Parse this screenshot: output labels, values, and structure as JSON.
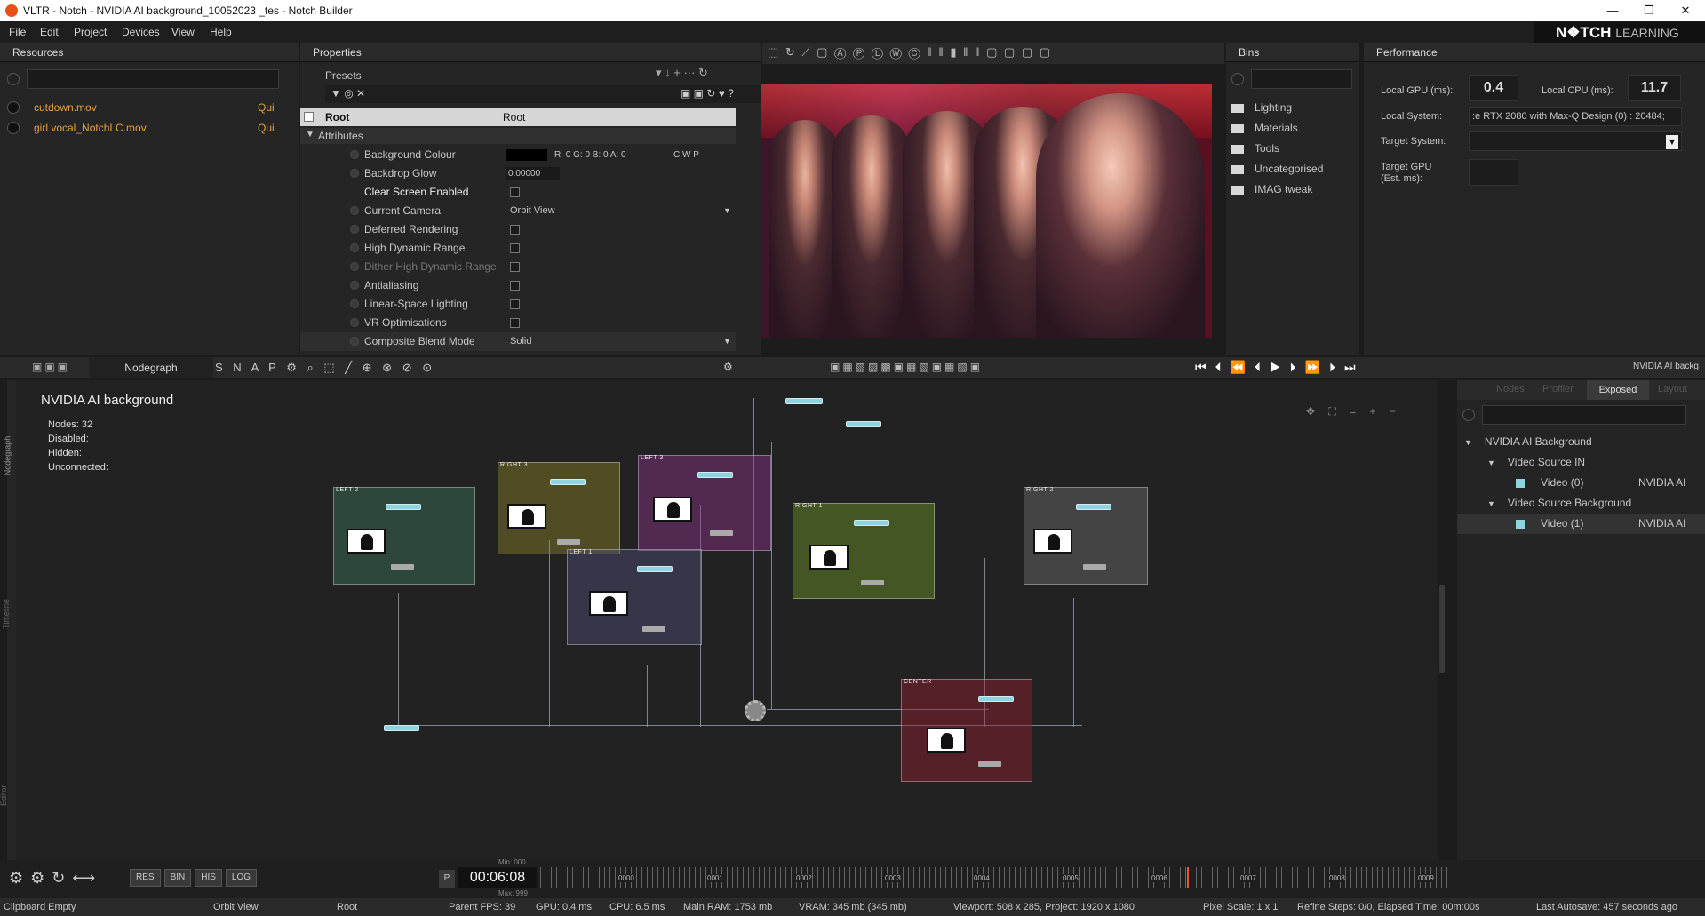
{
  "window": {
    "title": "VLTR - Notch - NVIDIA AI background_10052023 _tes - Notch Builder",
    "min": "—",
    "max": "❐",
    "close": "✕"
  },
  "menu": [
    "File",
    "Edit",
    "Project",
    "Devices",
    "View",
    "Help"
  ],
  "brand": {
    "name": "N❖TCH",
    "sub": "LEARNING"
  },
  "resources": {
    "title": "Resources",
    "items": [
      {
        "name": "cutdown.mov",
        "tag": "Qui"
      },
      {
        "name": "girl vocal_NotchLC.mov",
        "tag": "Qui"
      }
    ]
  },
  "properties": {
    "title": "Properties",
    "presets": "Presets",
    "root": {
      "label": "Root",
      "value": "Root"
    },
    "section": "Attributes",
    "rows": [
      {
        "label": "Background Colour",
        "value": "R: 0 G: 0 B: 0 A: 0",
        "extra": "C   W   P"
      },
      {
        "label": "Backdrop Glow",
        "value": "0.00000"
      },
      {
        "label": "Clear Screen Enabled",
        "value": ""
      },
      {
        "label": "Current Camera",
        "value": "Orbit View"
      },
      {
        "label": "Deferred Rendering",
        "value": ""
      },
      {
        "label": "High Dynamic Range",
        "value": ""
      },
      {
        "label": "Dither High Dynamic Range",
        "value": ""
      },
      {
        "label": "Antialiasing",
        "value": ""
      },
      {
        "label": "Linear-Space Lighting",
        "value": ""
      },
      {
        "label": "VR Optimisations",
        "value": ""
      },
      {
        "label": "Composite Blend Mode",
        "value": "Solid"
      }
    ]
  },
  "bins": {
    "title": "Bins",
    "items": [
      "Lighting",
      "Materials",
      "Tools",
      "Uncategorised",
      "IMAG tweak"
    ]
  },
  "performance": {
    "title": "Performance",
    "local_gpu_label": "Local GPU (ms):",
    "local_gpu": "0.4",
    "local_cpu_label": "Local CPU (ms):",
    "local_cpu": "11.7",
    "local_system_label": "Local System:",
    "local_system": ":e RTX 2080 with Max-Q Design (0) : 20484;",
    "target_system_label": "Target System:",
    "target_gpu_label": "Target GPU",
    "target_gpu_sub": "(Est. ms):"
  },
  "toolbar": {
    "snap": "S N A P",
    "nodegraph_tab": "Nodegraph",
    "viewport_label": "NVIDIA AI backg"
  },
  "nodegraph": {
    "title": "NVIDIA  AI  background",
    "nodes_label": "Nodes:",
    "nodes": "32",
    "disabled": "Disabled:",
    "hidden": "Hidden:",
    "unconnected": "Unconnected:",
    "side_tabs": [
      "Nodegraph",
      "Timeline",
      "Curve Editor"
    ],
    "groups": [
      "LEFT  2",
      "RIGHT  3",
      "LEFT  3",
      "LEFT  1",
      "RIGHT  1",
      "RIGHT  2",
      "CENTER"
    ]
  },
  "exposed": {
    "tabs": [
      "Nodes",
      "Profiler",
      "Exposed",
      "Layout"
    ],
    "tree": [
      {
        "label": "NVIDIA AI Background",
        "level": 0
      },
      {
        "label": "Video Source IN",
        "level": 1
      },
      {
        "label": "Video (0)",
        "level": 2,
        "value": "NVIDIA AI"
      },
      {
        "label": "Video Source Background",
        "level": 1
      },
      {
        "label": "Video (1)",
        "level": 2,
        "value": "NVIDIA AI"
      }
    ]
  },
  "timeline": {
    "buttons": [
      "RES",
      "BIN",
      "HIS",
      "LOG"
    ],
    "p": "P",
    "time": "00:06:08",
    "min": "Min: 000",
    "max": "Max: 999",
    "ticks": [
      "0000",
      "0001",
      "0002",
      "0003",
      "0004",
      "0005",
      "0006",
      "0007",
      "0008",
      "0009"
    ]
  },
  "status": {
    "clipboard": "Clipboard Empty",
    "view": "Orbit View",
    "root": "Root",
    "parent": "Parent  FPS: 39",
    "gpu": "GPU: 0.4 ms",
    "cpu": "CPU: 6.5 ms",
    "ram": "Main RAM: 1753 mb",
    "vram": "VRAM: 345 mb (345 mb)",
    "viewport": "Viewport: 508 x 285, Project: 1920 x 1080",
    "pixel": "Pixel Scale: 1 x 1",
    "refine": "Refine Steps: 0/0, Elapsed Time: 00m:00s",
    "autosave": "Last Autosave: 457 seconds ago"
  }
}
